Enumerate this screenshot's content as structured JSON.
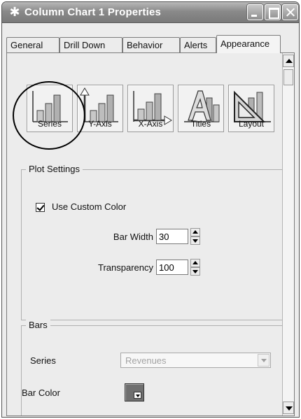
{
  "window": {
    "title": "Column Chart 1 Properties",
    "icons": {
      "title": "gear-icon",
      "minimize": "minimize-icon",
      "maximize": "maximize-icon",
      "close": "close-icon"
    }
  },
  "tabs": [
    {
      "label": "General"
    },
    {
      "label": "Drill Down"
    },
    {
      "label": "Behavior"
    },
    {
      "label": "Alerts"
    },
    {
      "label": "Appearance",
      "active": true
    }
  ],
  "appearance_buttons": [
    {
      "label": "Series",
      "icon": "bar-chart-series-icon",
      "highlighted": true
    },
    {
      "label": "Y-Axis",
      "icon": "bar-chart-y-axis-icon"
    },
    {
      "label": "X-Axis",
      "icon": "bar-chart-x-axis-icon"
    },
    {
      "label": "Titles",
      "icon": "titles-icon"
    },
    {
      "label": "Layout",
      "icon": "layout-icon"
    }
  ],
  "plot_settings": {
    "legend": "Plot Settings",
    "use_custom_color_label": "Use Custom Color",
    "use_custom_color_checked": true,
    "bar_width_label": "Bar Width",
    "bar_width_value": "30",
    "transparency_label": "Transparency",
    "transparency_value": "100"
  },
  "bars": {
    "legend": "Bars",
    "series_label": "Series",
    "series_value": "Revenues",
    "bar_color_label": "Bar Color",
    "bar_color_value": "#6f6f6f"
  }
}
